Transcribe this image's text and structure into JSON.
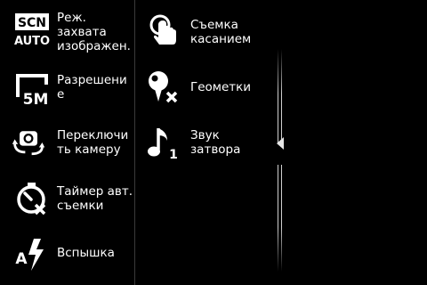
{
  "menu": {
    "left_column": [
      {
        "label": "Реж.\nзахвата\nизображен.",
        "icon": "scene-auto-icon",
        "icon_text_top": "SCN",
        "icon_text_bottom": "AUTO"
      },
      {
        "label": "Разрешени\nе",
        "icon": "resolution-icon",
        "icon_text": "5M"
      },
      {
        "label": "Переключи\nть камеру",
        "icon": "switch-camera-icon"
      },
      {
        "label": "Таймер авт.\nсъемки",
        "icon": "self-timer-off-icon"
      },
      {
        "label": "Вспышка",
        "icon": "flash-auto-icon",
        "icon_text": "A"
      }
    ],
    "right_column": [
      {
        "label": "Съемка\nкасанием",
        "icon": "touch-capture-icon"
      },
      {
        "label": "Геометки",
        "icon": "geotag-off-icon"
      },
      {
        "label": "Звук\nзатвора",
        "icon": "shutter-sound-icon",
        "icon_text": "1"
      }
    ]
  },
  "colors": {
    "background": "#000000",
    "text": "#ffffff",
    "divider": "#3a3a3a",
    "icon": "#ffffff"
  }
}
